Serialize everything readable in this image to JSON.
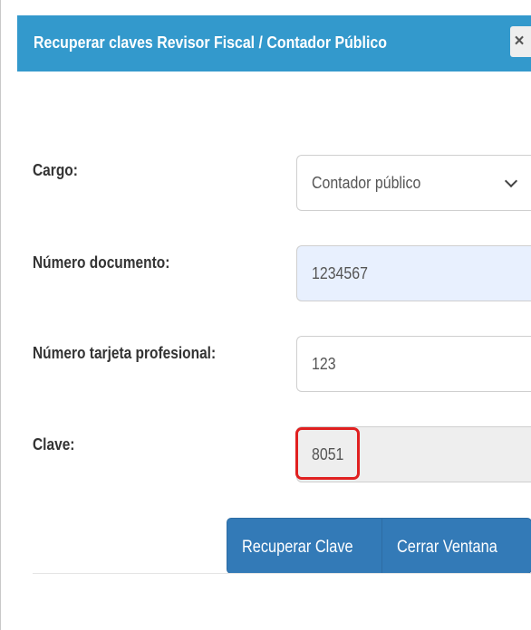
{
  "dialog": {
    "title": "Recuperar claves Revisor Fiscal / Contador Público",
    "close_label": "×"
  },
  "form": {
    "cargo": {
      "label": "Cargo:",
      "value": "Contador público"
    },
    "numero_documento": {
      "label": "Número documento:",
      "value": "1234567"
    },
    "tarjeta_profesional": {
      "label": "Número tarjeta profesional:",
      "value": "123"
    },
    "clave": {
      "label": "Clave:",
      "value": "8051"
    }
  },
  "buttons": {
    "recover": "Recuperar Clave",
    "close": "Cerrar Ventana"
  },
  "colors": {
    "header": "#3399cc",
    "primary_button": "#337ab7",
    "autofill_field": "#e8f0fe",
    "disabled_field": "#eeeeee",
    "highlight": "#e02020"
  }
}
